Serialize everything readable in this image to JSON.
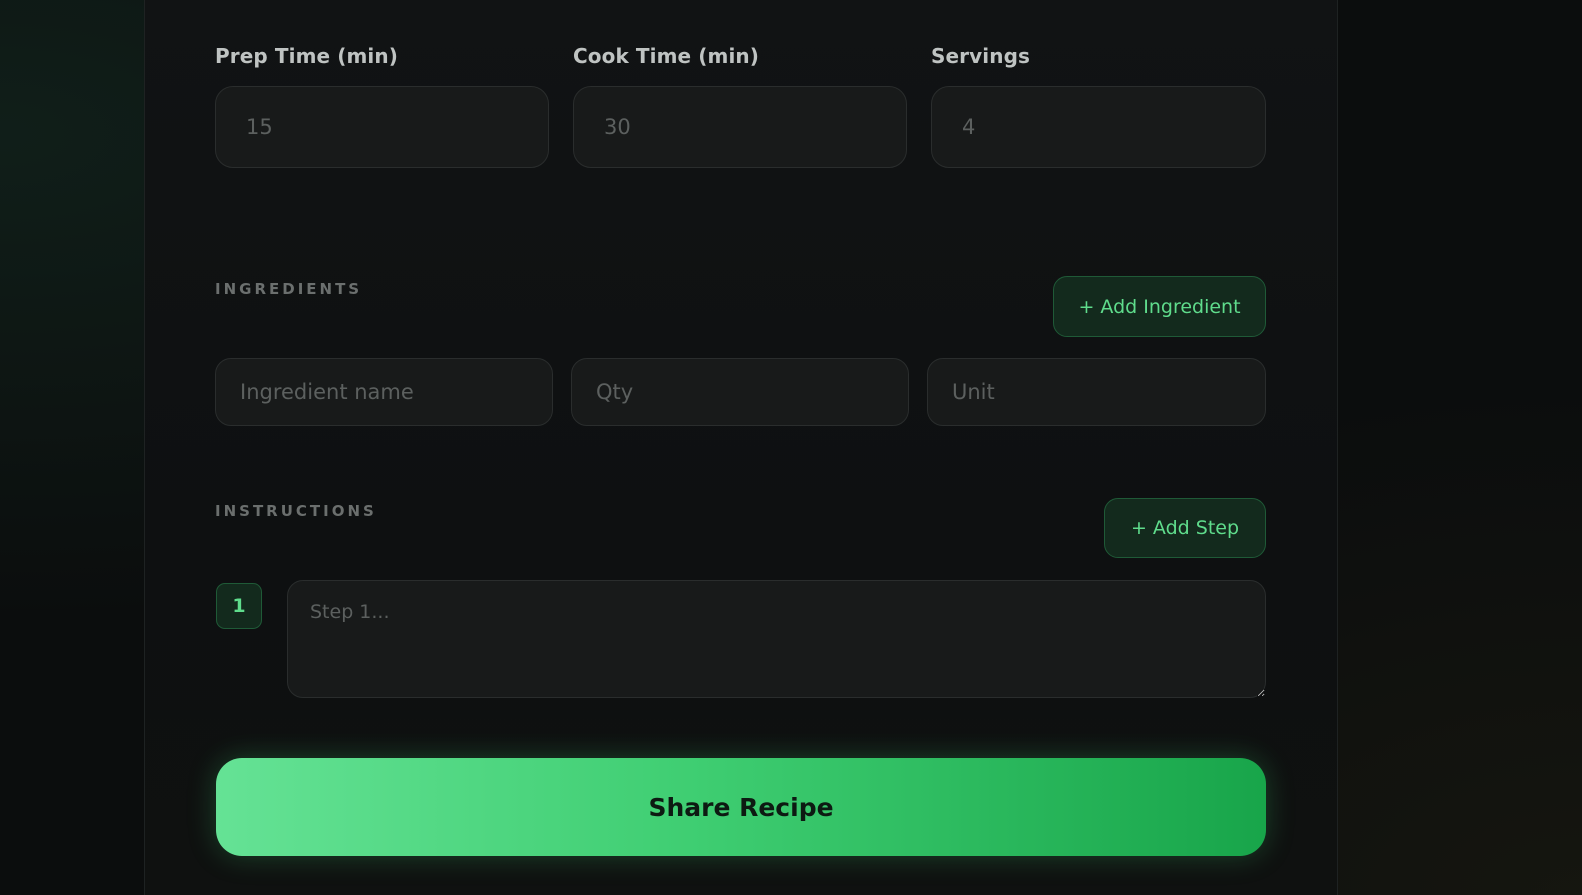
{
  "timing": {
    "prep_label": "Prep Time (min)",
    "prep_placeholder": "15",
    "cook_label": "Cook Time (min)",
    "cook_placeholder": "30",
    "servings_label": "Servings",
    "servings_placeholder": "4"
  },
  "ingredients": {
    "title": "INGREDIENTS",
    "add_label": "+ Add Ingredient",
    "name_placeholder": "Ingredient name",
    "qty_placeholder": "Qty",
    "unit_placeholder": "Unit"
  },
  "instructions": {
    "title": "INSTRUCTIONS",
    "add_label": "+ Add Step",
    "steps": [
      {
        "number": "1",
        "placeholder": "Step 1..."
      }
    ]
  },
  "submit": {
    "label": "Share Recipe"
  },
  "colors": {
    "accent": "#4ade80",
    "background": "#0b0d0d",
    "card": "#111314",
    "input": "#181a1a"
  }
}
